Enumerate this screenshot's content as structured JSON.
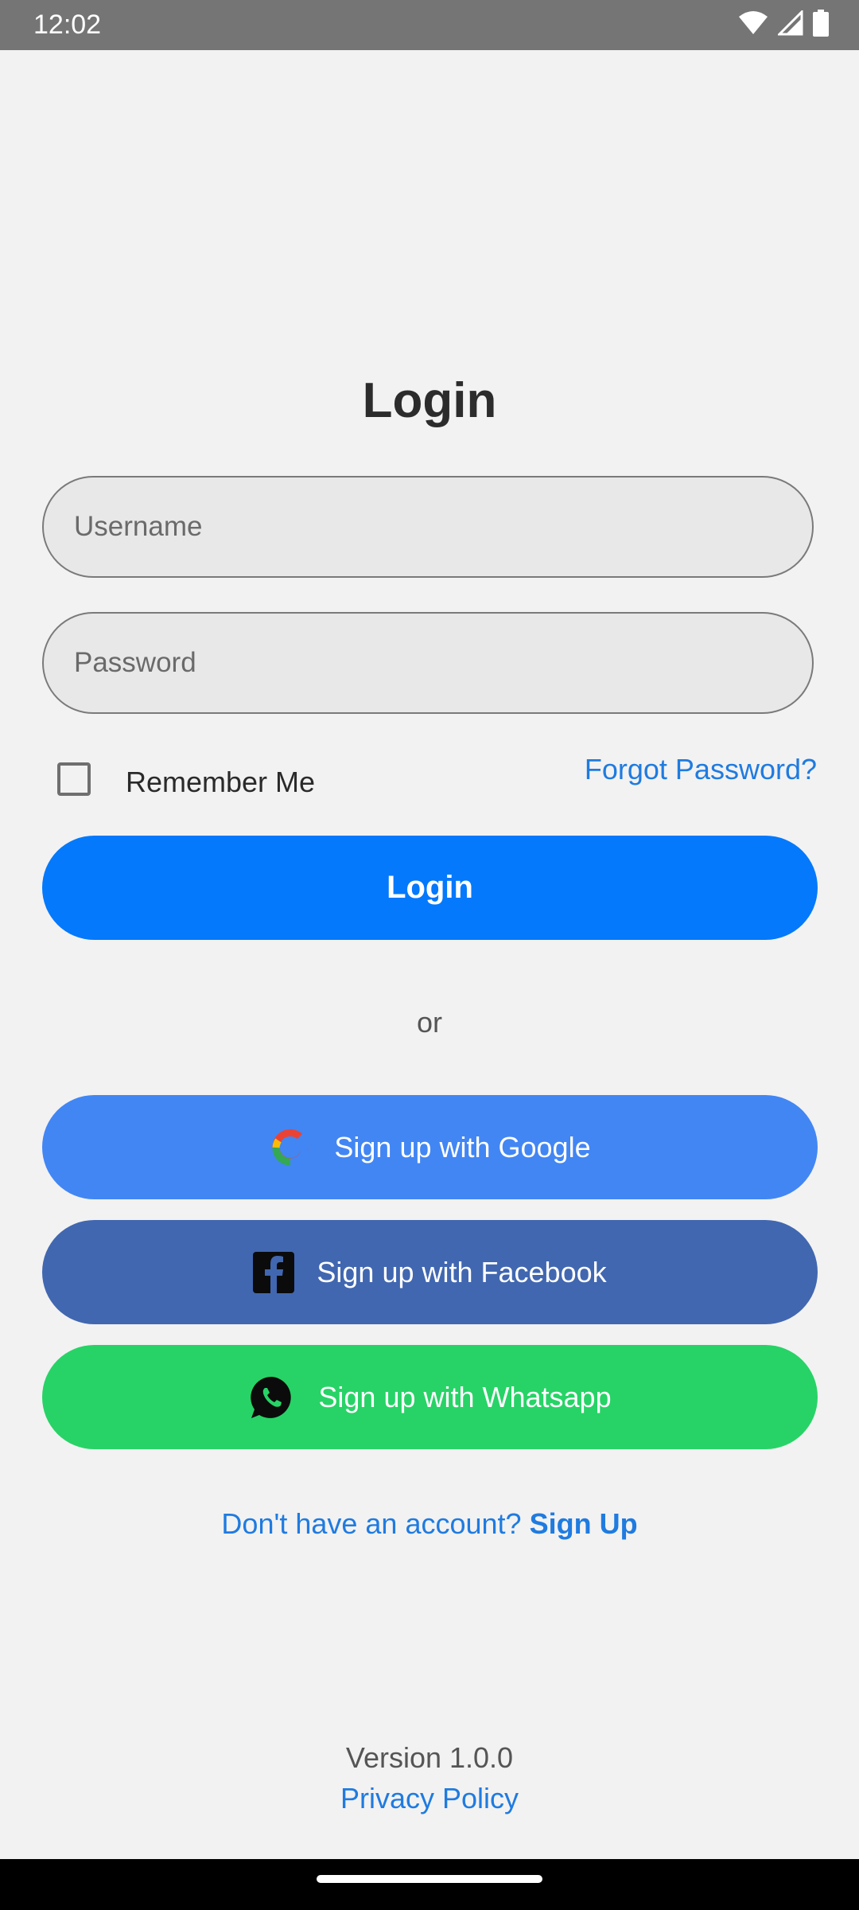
{
  "status_bar": {
    "time": "12:02"
  },
  "title": "Login",
  "username": {
    "placeholder": "Username",
    "value": ""
  },
  "password": {
    "placeholder": "Password",
    "value": ""
  },
  "remember": {
    "label": "Remember Me",
    "checked": false
  },
  "forgot_password": "Forgot Password?",
  "login_button": "Login",
  "or_text": "or",
  "social": {
    "google": "Sign up with Google",
    "facebook": "Sign up with Facebook",
    "whatsapp": "Sign up with Whatsapp"
  },
  "signup": {
    "prompt": "Don't have an account?",
    "link": "Sign Up"
  },
  "footer": {
    "version": "Version 1.0.0",
    "privacy": "Privacy Policy"
  },
  "icons": {
    "wifi": "wifi-icon",
    "signal": "cellular-signal-icon",
    "battery": "battery-icon",
    "google": "google-icon",
    "facebook": "facebook-icon",
    "whatsapp": "whatsapp-icon"
  },
  "colors": {
    "accent": "#0479fb",
    "link": "#1f7be0",
    "google": "#4286f4",
    "facebook": "#4167b0",
    "whatsapp": "#27d366",
    "background": "#f2f2f2"
  }
}
